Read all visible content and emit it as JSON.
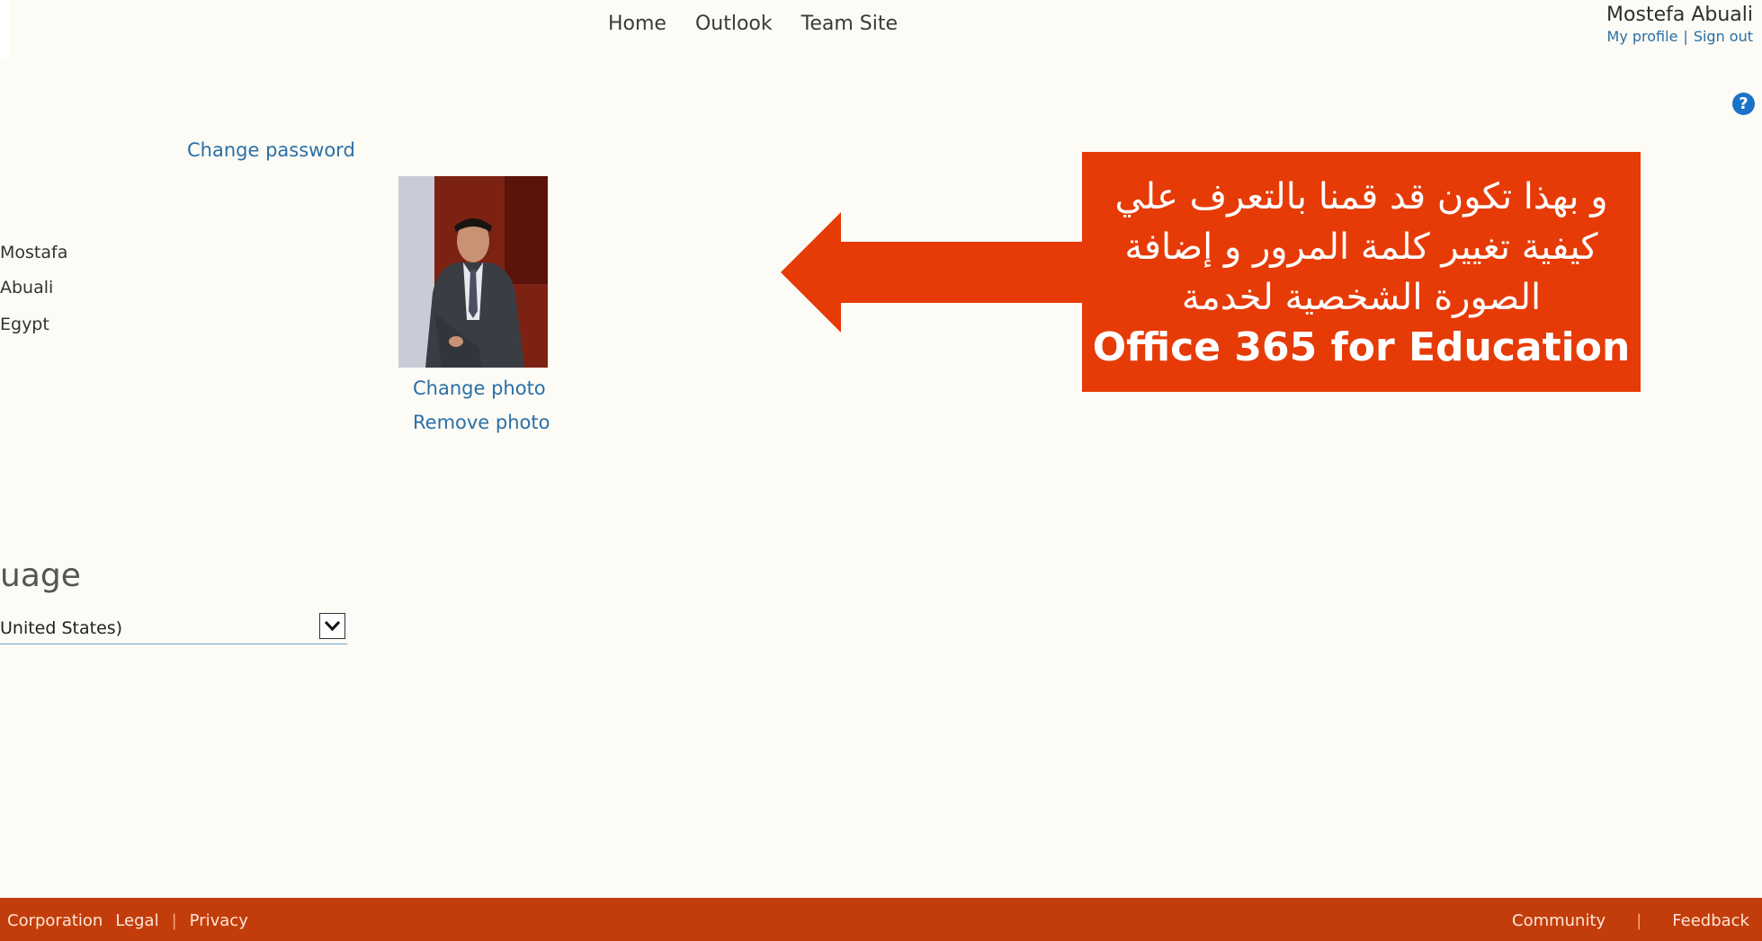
{
  "nav": [
    "Home",
    "Outlook",
    "Team Site"
  ],
  "user": {
    "name": "Mostefa Abuali",
    "profile_link": "My profile",
    "sign_out": "Sign out",
    "separator": "|"
  },
  "help_icon": "?",
  "account": {
    "change_password": "Change password",
    "first_name": "Mostafa",
    "last_name": "Abuali",
    "country": "Egypt"
  },
  "photo": {
    "change": "Change photo",
    "remove": "Remove photo"
  },
  "language": {
    "title": "uage",
    "selected": "United States)"
  },
  "callout": {
    "line1": "و بهذا تكون قد قمنا بالتعرف علي",
    "line2": "كيفية تغيير كلمة المرور و إضافة",
    "line3": "الصورة الشخصية لخدمة",
    "line4": "Office 365 for Education",
    "color": "#e63b07"
  },
  "footer": {
    "left": [
      "Corporation",
      "Legal",
      "Privacy"
    ],
    "right": [
      "Community",
      "Feedback"
    ],
    "separator": "|",
    "color": "#c23d0b"
  }
}
